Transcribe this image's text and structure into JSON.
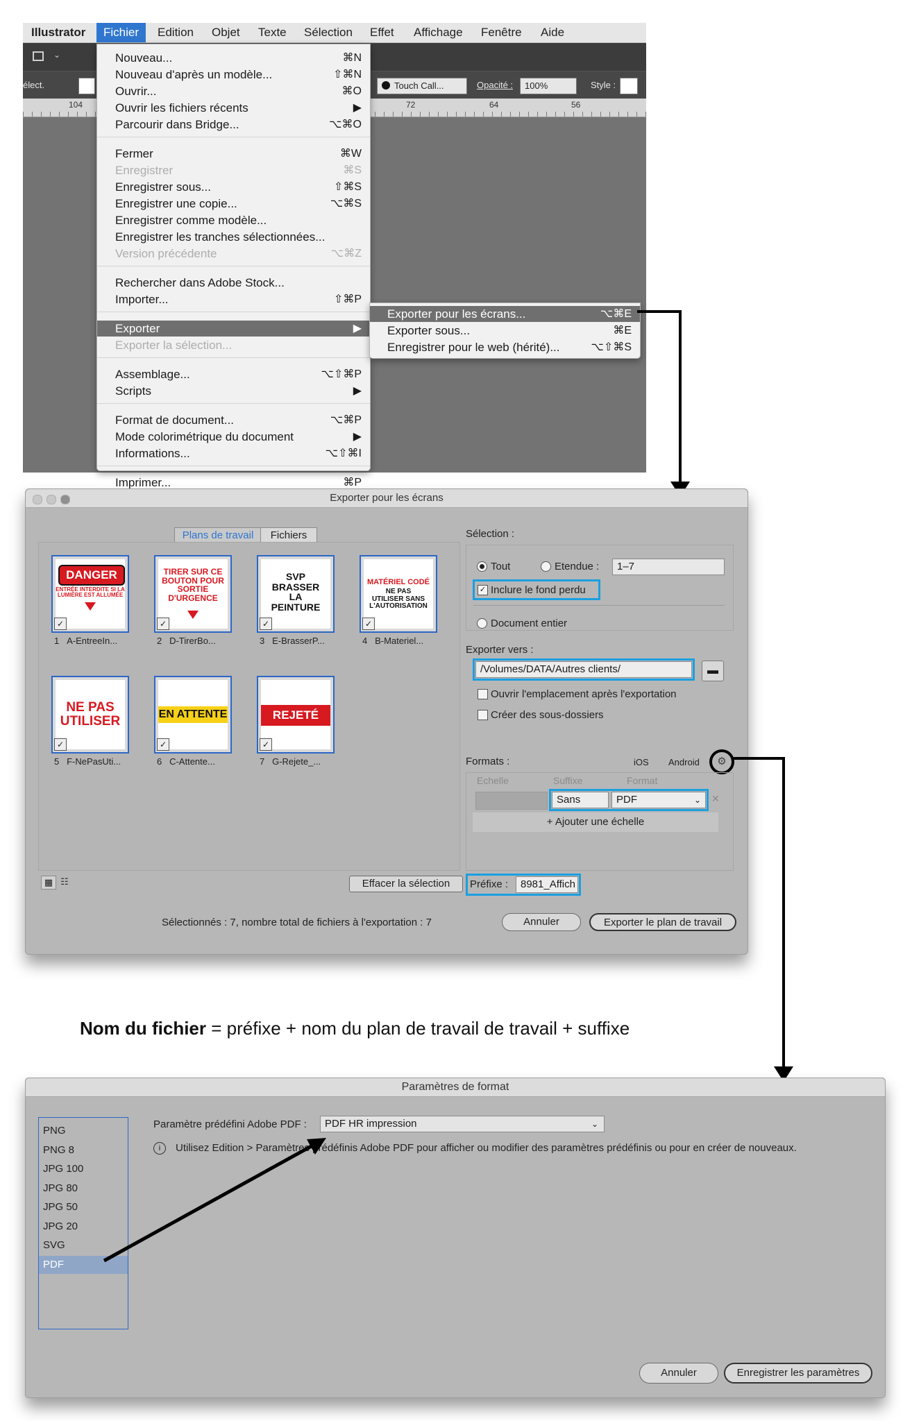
{
  "menubar": {
    "app": "Illustrator",
    "items": [
      "Fichier",
      "Edition",
      "Objet",
      "Texte",
      "Sélection",
      "Effet",
      "Affichage",
      "Fenêtre",
      "Aide"
    ]
  },
  "toolbar": {
    "select_label": "élect.",
    "brush_label": "Touch Call...",
    "opacity_label": "Opacité :",
    "opacity_value": "100%",
    "style_label": "Style :"
  },
  "ruler": [
    "104",
    "72",
    "64",
    "56"
  ],
  "file_menu": {
    "items": [
      {
        "label": "Nouveau...",
        "shortcut": "⌘N",
        "state": ""
      },
      {
        "label": "Nouveau d'après un modèle...",
        "shortcut": "⇧⌘N",
        "state": ""
      },
      {
        "label": "Ouvrir...",
        "shortcut": "⌘O",
        "state": ""
      },
      {
        "label": "Ouvrir les fichiers récents",
        "shortcut": "▶",
        "state": ""
      },
      {
        "label": "Parcourir dans Bridge...",
        "shortcut": "⌥⌘O",
        "state": ""
      },
      {
        "label": "Fermer",
        "shortcut": "⌘W",
        "state": ""
      },
      {
        "label": "Enregistrer",
        "shortcut": "⌘S",
        "state": "disabled"
      },
      {
        "label": "Enregistrer sous...",
        "shortcut": "⇧⌘S",
        "state": ""
      },
      {
        "label": "Enregistrer une copie...",
        "shortcut": "⌥⌘S",
        "state": ""
      },
      {
        "label": "Enregistrer comme modèle...",
        "shortcut": "",
        "state": ""
      },
      {
        "label": "Enregistrer les tranches sélectionnées...",
        "shortcut": "",
        "state": ""
      },
      {
        "label": "Version précédente",
        "shortcut": "⌥⌘Z",
        "state": "disabled"
      },
      {
        "label": "Rechercher dans Adobe Stock...",
        "shortcut": "",
        "state": ""
      },
      {
        "label": "Importer...",
        "shortcut": "⇧⌘P",
        "state": ""
      },
      {
        "label": "Exporter",
        "shortcut": "▶",
        "state": "highlighted"
      },
      {
        "label": "Exporter la sélection...",
        "shortcut": "",
        "state": "disabled"
      },
      {
        "label": "Assemblage...",
        "shortcut": "⌥⇧⌘P",
        "state": ""
      },
      {
        "label": "Scripts",
        "shortcut": "▶",
        "state": ""
      },
      {
        "label": "Format de document...",
        "shortcut": "⌥⌘P",
        "state": ""
      },
      {
        "label": "Mode colorimétrique du document",
        "shortcut": "▶",
        "state": ""
      },
      {
        "label": "Informations...",
        "shortcut": "⌥⇧⌘I",
        "state": ""
      },
      {
        "label": "Imprimer...",
        "shortcut": "⌘P",
        "state": ""
      }
    ]
  },
  "export_submenu": {
    "items": [
      {
        "label": "Exporter pour les écrans...",
        "shortcut": "⌥⌘E",
        "state": "highlighted"
      },
      {
        "label": "Exporter sous...",
        "shortcut": "⌘E",
        "state": ""
      },
      {
        "label": "Enregistrer pour le web (hérité)...",
        "shortcut": "⌥⇧⌘S",
        "state": ""
      }
    ]
  },
  "export_dialog": {
    "title": "Exporter pour les écrans",
    "tabs": [
      "Plans de travail",
      "Fichiers"
    ],
    "artboards": [
      {
        "num": "1",
        "name": "A-EntreeIn...",
        "sign": "DANGER",
        "sub": "ENTRÉE INTERDITE SI LA LUMIÈRE EST ALLUMÉE"
      },
      {
        "num": "2",
        "name": "D-TirerBo...",
        "sign": "TIRER SUR CE BOUTON POUR SORTIE D'URGENCE",
        "sub": ""
      },
      {
        "num": "3",
        "name": "E-BrasserP...",
        "sign": "SVP BRASSER LA PEINTURE",
        "sub": ""
      },
      {
        "num": "4",
        "name": "B-Materiel...",
        "sign": "MATÉRIEL CODÉ",
        "sub": "NE PAS UTILISER SANS L'AUTORISATION"
      },
      {
        "num": "5",
        "name": "F-NePasUti...",
        "sign": "NE PAS UTILISER",
        "sub": ""
      },
      {
        "num": "6",
        "name": "C-Attente...",
        "sign": "EN ATTENTE",
        "sub": ""
      },
      {
        "num": "7",
        "name": "G-Rejete_...",
        "sign": "REJETÉ",
        "sub": ""
      }
    ],
    "selection_label": "Sélection :",
    "radio_all": "Tout",
    "radio_range": "Etendue :",
    "range_value": "1–7",
    "include_bleed": "Inclure le fond perdu",
    "whole_document": "Document entier",
    "export_to_label": "Exporter vers :",
    "export_path": "/Volumes/DATA/Autres clients/",
    "open_location": "Ouvrir l'emplacement après l'exportation",
    "create_subfolders": "Créer des sous-dossiers",
    "formats_label": "Formats :",
    "ios": "iOS",
    "android": "Android",
    "col_scale": "Echelle",
    "col_suffix": "Suffixe",
    "col_format": "Format",
    "suffix_value": "Sans",
    "format_value": "PDF",
    "add_scale": "+ Ajouter une échelle",
    "clear_selection": "Effacer la sélection",
    "prefix_label": "Préfixe :",
    "prefix_value": "8981_Affich",
    "status": "Sélectionnés : 7, nombre total de fichiers à l'exportation : 7",
    "cancel": "Annuler",
    "export_btn": "Exporter le plan de travail"
  },
  "formula": {
    "bold": "Nom du fichier",
    "rest": " = préfixe + nom du plan de travail de travail + suffixe"
  },
  "format_dialog": {
    "title": "Paramètres de format",
    "formats": [
      "PNG",
      "PNG 8",
      "JPG 100",
      "JPG 80",
      "JPG 50",
      "JPG 20",
      "SVG",
      "PDF"
    ],
    "selected": "PDF",
    "preset_label": "Paramètre prédéfini Adobe PDF :",
    "preset_value": "PDF HR impression",
    "info": "Utilisez Edition > Paramètres prédéfinis Adobe PDF pour afficher ou modifier des paramètres prédéfinis ou pour en créer de nouveaux.",
    "cancel": "Annuler",
    "save": "Enregistrer les paramètres"
  },
  "colors": {
    "accent": "#2f76cf",
    "highlight_box": "#1b9fe0",
    "sign_red": "#d71920",
    "sign_yellow": "#f7d117"
  }
}
